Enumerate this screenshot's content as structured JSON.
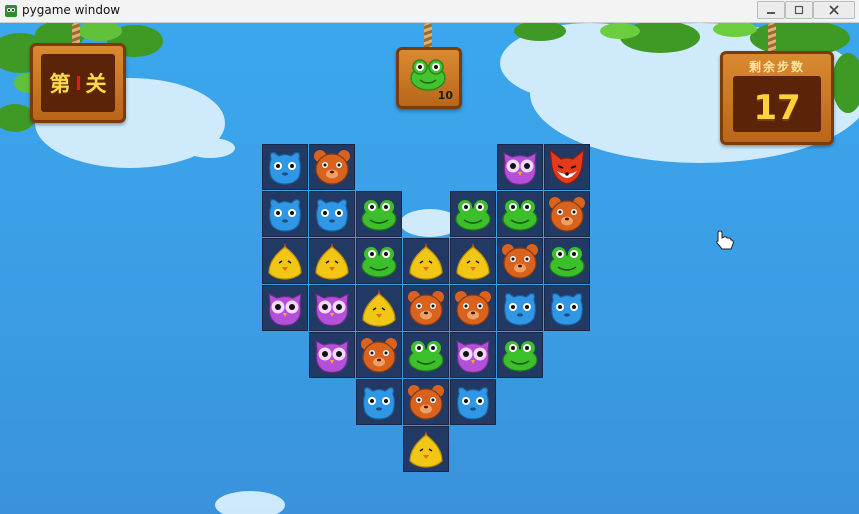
{
  "window": {
    "title": "pygame window"
  },
  "hud": {
    "level_label_left": "第",
    "level_label_right": "关",
    "goal": {
      "icon": "frog-icon",
      "count": "10"
    },
    "steps": {
      "label": "剩余步数",
      "value": "17"
    }
  },
  "colors": {
    "owl": "#b44fd8",
    "bear": "#d9621f",
    "frog": "#3dbf2c",
    "chick": "#f2c614",
    "blue": "#2f97e6",
    "fox": "#e33a1b",
    "board_cell": "#223a63"
  },
  "board": [
    [
      "blue",
      "bear",
      null,
      null,
      null,
      "owl",
      "fox"
    ],
    [
      "blue",
      "blue",
      "frog",
      null,
      "frog",
      "frog",
      "bear"
    ],
    [
      "chick",
      "chick",
      "frog",
      "chick",
      "chick",
      "bear",
      "frog"
    ],
    [
      "owl",
      "owl",
      "chick",
      "bear",
      "bear",
      "blue",
      "blue"
    ],
    [
      null,
      "owl",
      "bear",
      "frog",
      "owl",
      "frog",
      null
    ],
    [
      null,
      null,
      "blue",
      "bear",
      "blue",
      null,
      null
    ],
    [
      null,
      null,
      null,
      "chick",
      null,
      null,
      null
    ]
  ]
}
